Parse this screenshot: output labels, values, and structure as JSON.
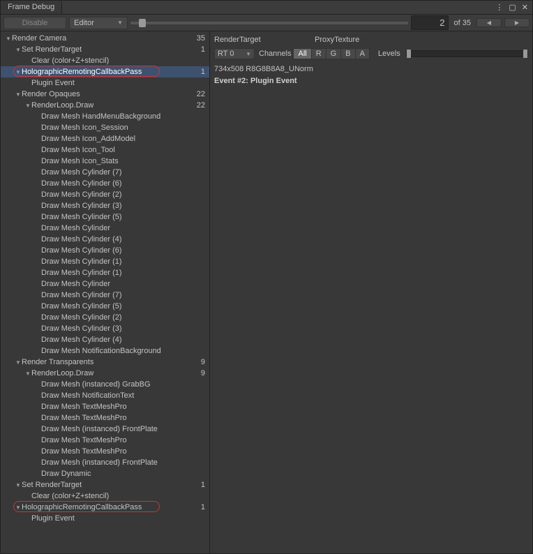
{
  "window": {
    "title": "Frame Debug"
  },
  "toolbar": {
    "disable": "Disable",
    "source": "Editor",
    "current": "2",
    "of_prefix": "of ",
    "total": "35"
  },
  "detail": {
    "rt_label": "RenderTarget",
    "rt_value": "ProxyTexture",
    "rt_dropdown": "RT 0",
    "channels_label": "Channels",
    "chan_all": "All",
    "chan_r": "R",
    "chan_g": "G",
    "chan_b": "B",
    "chan_a": "A",
    "levels_label": "Levels",
    "dims": "734x508 R8G8B8A8_UNorm",
    "event": "Event #2: Plugin Event"
  },
  "tree": [
    {
      "d": 0,
      "t": 1,
      "l": "Render Camera",
      "c": "35"
    },
    {
      "d": 1,
      "t": 1,
      "l": "Set RenderTarget",
      "c": "1"
    },
    {
      "d": 2,
      "t": 0,
      "l": "Clear (color+Z+stencil)"
    },
    {
      "d": 1,
      "t": 1,
      "l": "HolographicRemotingCallbackPass",
      "c": "1",
      "sel": 1,
      "mark": 1
    },
    {
      "d": 2,
      "t": 0,
      "l": "Plugin Event"
    },
    {
      "d": 1,
      "t": 1,
      "l": "Render Opaques",
      "c": "22"
    },
    {
      "d": 2,
      "t": 1,
      "l": "RenderLoop.Draw",
      "c": "22"
    },
    {
      "d": 3,
      "t": 0,
      "l": "Draw Mesh HandMenuBackground"
    },
    {
      "d": 3,
      "t": 0,
      "l": "Draw Mesh Icon_Session"
    },
    {
      "d": 3,
      "t": 0,
      "l": "Draw Mesh Icon_AddModel"
    },
    {
      "d": 3,
      "t": 0,
      "l": "Draw Mesh Icon_Tool"
    },
    {
      "d": 3,
      "t": 0,
      "l": "Draw Mesh Icon_Stats"
    },
    {
      "d": 3,
      "t": 0,
      "l": "Draw Mesh Cylinder (7)"
    },
    {
      "d": 3,
      "t": 0,
      "l": "Draw Mesh Cylinder (6)"
    },
    {
      "d": 3,
      "t": 0,
      "l": "Draw Mesh Cylinder (2)"
    },
    {
      "d": 3,
      "t": 0,
      "l": "Draw Mesh Cylinder (3)"
    },
    {
      "d": 3,
      "t": 0,
      "l": "Draw Mesh Cylinder (5)"
    },
    {
      "d": 3,
      "t": 0,
      "l": "Draw Mesh Cylinder"
    },
    {
      "d": 3,
      "t": 0,
      "l": "Draw Mesh Cylinder (4)"
    },
    {
      "d": 3,
      "t": 0,
      "l": "Draw Mesh Cylinder (6)"
    },
    {
      "d": 3,
      "t": 0,
      "l": "Draw Mesh Cylinder (1)"
    },
    {
      "d": 3,
      "t": 0,
      "l": "Draw Mesh Cylinder (1)"
    },
    {
      "d": 3,
      "t": 0,
      "l": "Draw Mesh Cylinder"
    },
    {
      "d": 3,
      "t": 0,
      "l": "Draw Mesh Cylinder (7)"
    },
    {
      "d": 3,
      "t": 0,
      "l": "Draw Mesh Cylinder (5)"
    },
    {
      "d": 3,
      "t": 0,
      "l": "Draw Mesh Cylinder (2)"
    },
    {
      "d": 3,
      "t": 0,
      "l": "Draw Mesh Cylinder (3)"
    },
    {
      "d": 3,
      "t": 0,
      "l": "Draw Mesh Cylinder (4)"
    },
    {
      "d": 3,
      "t": 0,
      "l": "Draw Mesh NotificationBackground"
    },
    {
      "d": 1,
      "t": 1,
      "l": "Render Transparents",
      "c": "9"
    },
    {
      "d": 2,
      "t": 1,
      "l": "RenderLoop.Draw",
      "c": "9"
    },
    {
      "d": 3,
      "t": 0,
      "l": "Draw Mesh (instanced) GrabBG"
    },
    {
      "d": 3,
      "t": 0,
      "l": "Draw Mesh NotificationText"
    },
    {
      "d": 3,
      "t": 0,
      "l": "Draw Mesh TextMeshPro"
    },
    {
      "d": 3,
      "t": 0,
      "l": "Draw Mesh TextMeshPro"
    },
    {
      "d": 3,
      "t": 0,
      "l": "Draw Mesh (instanced) FrontPlate"
    },
    {
      "d": 3,
      "t": 0,
      "l": "Draw Mesh TextMeshPro"
    },
    {
      "d": 3,
      "t": 0,
      "l": "Draw Mesh TextMeshPro"
    },
    {
      "d": 3,
      "t": 0,
      "l": "Draw Mesh (instanced) FrontPlate"
    },
    {
      "d": 3,
      "t": 0,
      "l": "Draw Dynamic"
    },
    {
      "d": 1,
      "t": 1,
      "l": "Set RenderTarget",
      "c": "1"
    },
    {
      "d": 2,
      "t": 0,
      "l": "Clear (color+Z+stencil)"
    },
    {
      "d": 1,
      "t": 1,
      "l": "HolographicRemotingCallbackPass",
      "c": "1",
      "mark": 1
    },
    {
      "d": 2,
      "t": 0,
      "l": "Plugin Event"
    }
  ]
}
